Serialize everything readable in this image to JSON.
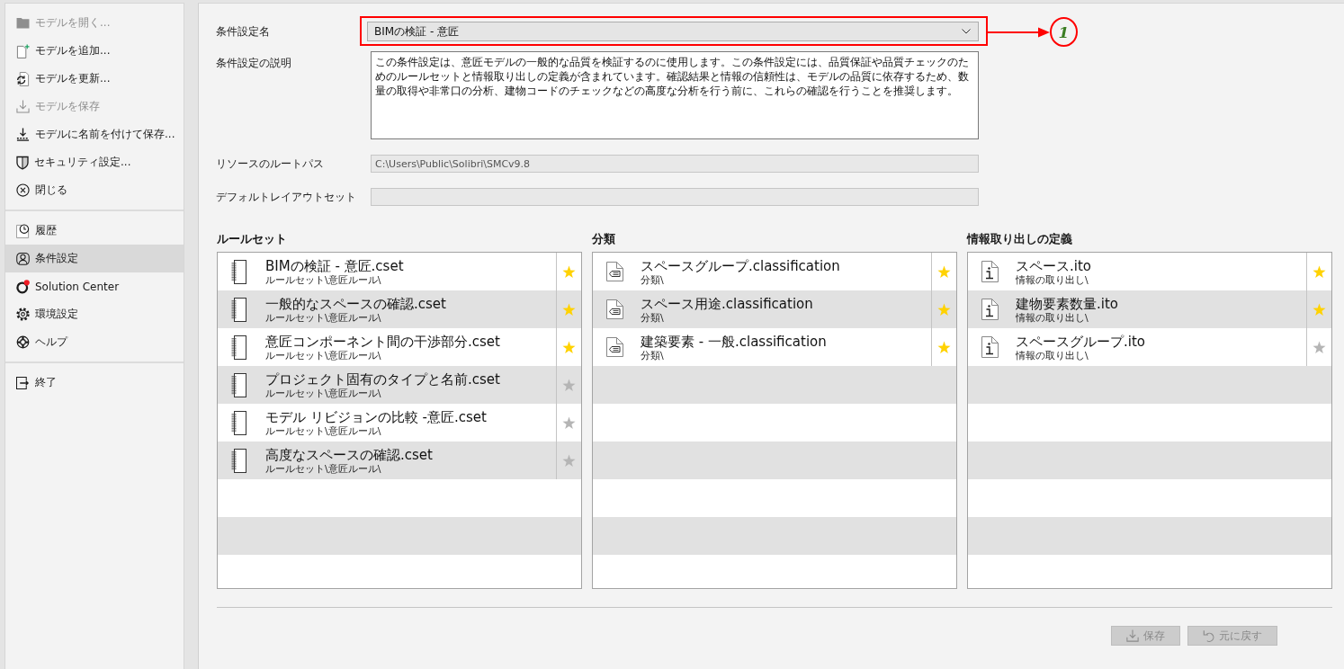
{
  "sidebar": {
    "groups": [
      {
        "items": [
          {
            "label": "モデルを開く...",
            "disabled": true,
            "selected": false
          },
          {
            "label": "モデルを追加...",
            "disabled": false,
            "selected": false
          },
          {
            "label": "モデルを更新...",
            "disabled": false,
            "selected": false
          },
          {
            "label": "モデルを保存",
            "disabled": true,
            "selected": false
          },
          {
            "label": "モデルに名前を付けて保存...",
            "disabled": false,
            "selected": false
          },
          {
            "label": "セキュリティ設定...",
            "disabled": false,
            "selected": false
          },
          {
            "label": "閉じる",
            "disabled": false,
            "selected": false
          }
        ]
      },
      {
        "items": [
          {
            "label": "履歴",
            "disabled": false,
            "selected": false
          },
          {
            "label": "条件設定",
            "disabled": false,
            "selected": true
          },
          {
            "label": "Solution Center",
            "disabled": false,
            "selected": false
          },
          {
            "label": "環境設定",
            "disabled": false,
            "selected": false
          },
          {
            "label": "ヘルプ",
            "disabled": false,
            "selected": false
          }
        ]
      },
      {
        "items": [
          {
            "label": "終了",
            "disabled": false,
            "selected": false
          }
        ]
      }
    ]
  },
  "fields": [
    {
      "kind": "dropdown",
      "label": "条件設定名",
      "value": "BIMの検証 - 意匠"
    },
    {
      "kind": "textarea",
      "label": "条件設定の説明",
      "value": "この条件設定は、意匠モデルの一般的な品質を検証するのに使用します。この条件設定には、品質保証や品質チェックのためのルールセットと情報取り出しの定義が含まれています。確認結果と情報の信頼性は、モデルの品質に依存するため、数量の取得や非常口の分析、建物コードのチェックなどの高度な分析を行う前に、これらの確認を行うことを推奨します。"
    },
    {
      "kind": "readonly",
      "label": "リソースのルートパス",
      "value": "C:\\Users\\Public\\Solibri\\SMCv9.8"
    },
    {
      "kind": "readonly",
      "label": "デフォルトレイアウトセット"
    }
  ],
  "callout": {
    "label": "1"
  },
  "panels": [
    {
      "kind": "ruleset",
      "title": "ルールセット",
      "items": [
        {
          "name": "BIMの検証 - 意匠.cset",
          "path": "ルールセット\\意匠ルール\\",
          "favorite": true
        },
        {
          "name": "一般的なスペースの確認.cset",
          "path": "ルールセット\\意匠ルール\\",
          "favorite": true
        },
        {
          "name": "意匠コンポーネント間の干渉部分.cset",
          "path": "ルールセット\\意匠ルール\\",
          "favorite": true
        },
        {
          "name": "プロジェクト固有のタイプと名前.cset",
          "path": "ルールセット\\意匠ルール\\",
          "favorite": false
        },
        {
          "name": "モデル リビジョンの比較 -意匠.cset",
          "path": "ルールセット\\意匠ルール\\",
          "favorite": false
        },
        {
          "name": "高度なスペースの確認.cset",
          "path": "ルールセット\\意匠ルール\\",
          "favorite": false
        }
      ]
    },
    {
      "kind": "classification",
      "title": "分類",
      "items": [
        {
          "name": "スペースグループ.classification",
          "path": "分類\\",
          "favorite": true
        },
        {
          "name": "スペース用途.classification",
          "path": "分類\\",
          "favorite": true
        },
        {
          "name": "建築要素 - 一般.classification",
          "path": "分類\\",
          "favorite": true
        }
      ]
    },
    {
      "kind": "information",
      "title": "情報取り出しの定義",
      "items": [
        {
          "name": "スペース.ito",
          "path": "情報の取り出し\\",
          "favorite": true
        },
        {
          "name": "建物要素数量.ito",
          "path": "情報の取り出し\\",
          "favorite": true
        },
        {
          "name": "スペースグループ.ito",
          "path": "情報の取り出し\\",
          "favorite": false
        }
      ]
    }
  ],
  "buttons": [
    {
      "label": "保存",
      "disabled": true
    },
    {
      "label": "元に戻す",
      "disabled": true
    }
  ]
}
